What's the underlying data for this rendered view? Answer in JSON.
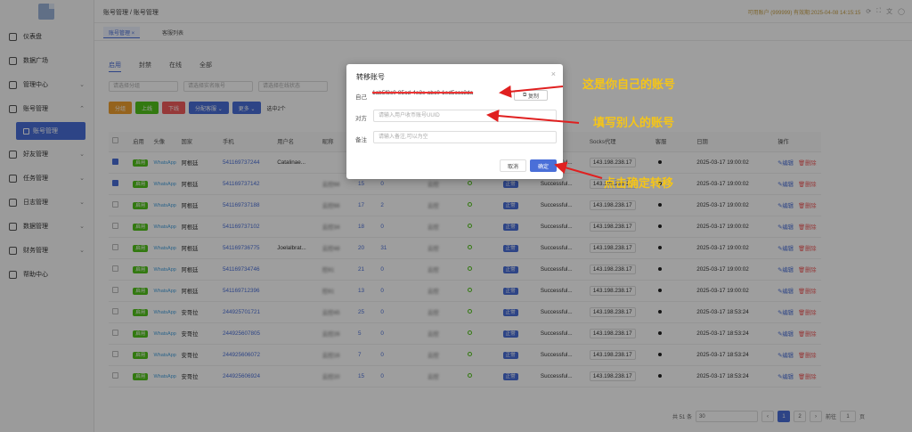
{
  "header": {
    "breadcrumb": "账号管理 / 账号管理",
    "info": "可用账户 (999999) 有效期:2025-04-08 14:15:15"
  },
  "tabs_bar": {
    "active": "账号管理 ×",
    "other": "客服列表"
  },
  "sidebar": {
    "items": [
      {
        "label": "仪表盘",
        "chevron": ""
      },
      {
        "label": "数据广场",
        "chevron": ""
      },
      {
        "label": "管理中心",
        "chevron": "⌄"
      },
      {
        "label": "账号管理",
        "chevron": "⌃"
      },
      {
        "label": "好友管理",
        "chevron": "⌄"
      },
      {
        "label": "任务管理",
        "chevron": "⌄"
      },
      {
        "label": "日志管理",
        "chevron": "⌄"
      },
      {
        "label": "数据管理",
        "chevron": "⌄"
      },
      {
        "label": "财务管理",
        "chevron": "⌄"
      },
      {
        "label": "帮助中心",
        "chevron": ""
      }
    ],
    "sub_active": "账号管理"
  },
  "filter_tabs": [
    "启用",
    "封禁",
    "在线",
    "全部"
  ],
  "selects": [
    "请选择分组",
    "请选择实名账号",
    "请选择在线状态"
  ],
  "buttons": {
    "b1": "分组",
    "b2": "上线",
    "b3": "下线",
    "b4": "分配客服 ⌄",
    "b5": "更多 ⌄",
    "selected": "选中2个"
  },
  "table": {
    "headers": [
      "",
      "启用",
      "头像",
      "国家",
      "手机",
      "用户名",
      "昵称",
      "",
      "",
      "",
      "",
      "",
      "Socks代理",
      "客服",
      "日期",
      "",
      "操作"
    ],
    "rows": [
      {
        "checked": true,
        "country": "阿根廷",
        "phone": "541169737244",
        "username": "Catalinae...",
        "nick": "",
        "n1": "15",
        "n2": "0",
        "ctrl": "云控",
        "ip": "143.198.238.17",
        "date": "2025-03-17 19:00:02"
      },
      {
        "checked": true,
        "country": "阿根廷",
        "phone": "541169737142",
        "username": "",
        "nick": "云控66",
        "n1": "15",
        "n2": "0",
        "ctrl": "云控",
        "ip": "143.198.238.17",
        "date": "2025-03-17 19:00:02"
      },
      {
        "checked": false,
        "country": "阿根廷",
        "phone": "541169737188",
        "username": "",
        "nick": "云控66",
        "n1": "17",
        "n2": "2",
        "ctrl": "云控",
        "ip": "143.198.238.17",
        "date": "2025-03-17 19:00:02"
      },
      {
        "checked": false,
        "country": "阿根廷",
        "phone": "541169737102",
        "username": "",
        "nick": "云控34",
        "n1": "18",
        "n2": "0",
        "ctrl": "云控",
        "ip": "143.198.238.17",
        "date": "2025-03-17 19:00:02"
      },
      {
        "checked": false,
        "country": "阿根廷",
        "phone": "541169736775",
        "username": "Joelalbrat...",
        "nick": "云控48",
        "n1": "20",
        "n2": "31",
        "ctrl": "云控",
        "ip": "143.198.238.17",
        "date": "2025-03-17 19:00:02"
      },
      {
        "checked": false,
        "country": "阿根廷",
        "phone": "541169734746",
        "username": "",
        "nick": "控81",
        "n1": "21",
        "n2": "0",
        "ctrl": "云控",
        "ip": "143.198.238.17",
        "date": "2025-03-17 19:00:02"
      },
      {
        "checked": false,
        "country": "阿根廷",
        "phone": "541169712396",
        "username": "",
        "nick": "控81",
        "n1": "13",
        "n2": "0",
        "ctrl": "云控",
        "ip": "143.198.238.17",
        "date": "2025-03-17 19:00:02"
      },
      {
        "checked": false,
        "country": "安哥拉",
        "phone": "244925701721",
        "username": "",
        "nick": "云控45",
        "n1": "25",
        "n2": "0",
        "ctrl": "云控",
        "ip": "143.198.238.17",
        "date": "2025-03-17 18:53:24"
      },
      {
        "checked": false,
        "country": "安哥拉",
        "phone": "244925607805",
        "username": "",
        "nick": "云控26",
        "n1": "5",
        "n2": "0",
        "ctrl": "云控",
        "ip": "143.198.238.17",
        "date": "2025-03-17 18:53:24"
      },
      {
        "checked": false,
        "country": "安哥拉",
        "phone": "244925606072",
        "username": "",
        "nick": "云控16",
        "n1": "7",
        "n2": "0",
        "ctrl": "云控",
        "ip": "143.198.238.17",
        "date": "2025-03-17 18:53:24"
      },
      {
        "checked": false,
        "country": "安哥拉",
        "phone": "244925606924",
        "username": "",
        "nick": "云控20",
        "n1": "15",
        "n2": "0",
        "ctrl": "云控",
        "ip": "143.198.238.17",
        "date": "2025-03-17 18:53:24"
      }
    ],
    "enabled_tag": "启用",
    "avatar_tag": "WhatsApp",
    "status_tag": "正常",
    "socks_status": "Successful...",
    "edit": "编辑",
    "delete": "删除"
  },
  "pager": {
    "total": "共 51 条",
    "per_page": "30",
    "pages": [
      "1",
      "2"
    ],
    "goto": "前往",
    "goto_val": "1",
    "page_suffix": "页"
  },
  "modal": {
    "title": "转移账号",
    "self_label": "自己",
    "self_value": "1ab5f3c0-85cd-4e3e-abc0-1ed5ccc3da",
    "copy": "复制",
    "target_label": "对方",
    "target_placeholder": "请输入用户收币账号UUID",
    "note_label": "备注",
    "note_placeholder": "请输入备注,可以为空",
    "cancel": "取消",
    "ok": "确定"
  },
  "annotations": {
    "a1": "这是你自己的账号",
    "a2": "填写别人的账号",
    "a3": "点击确定转移",
    "color": "#f5c518"
  }
}
